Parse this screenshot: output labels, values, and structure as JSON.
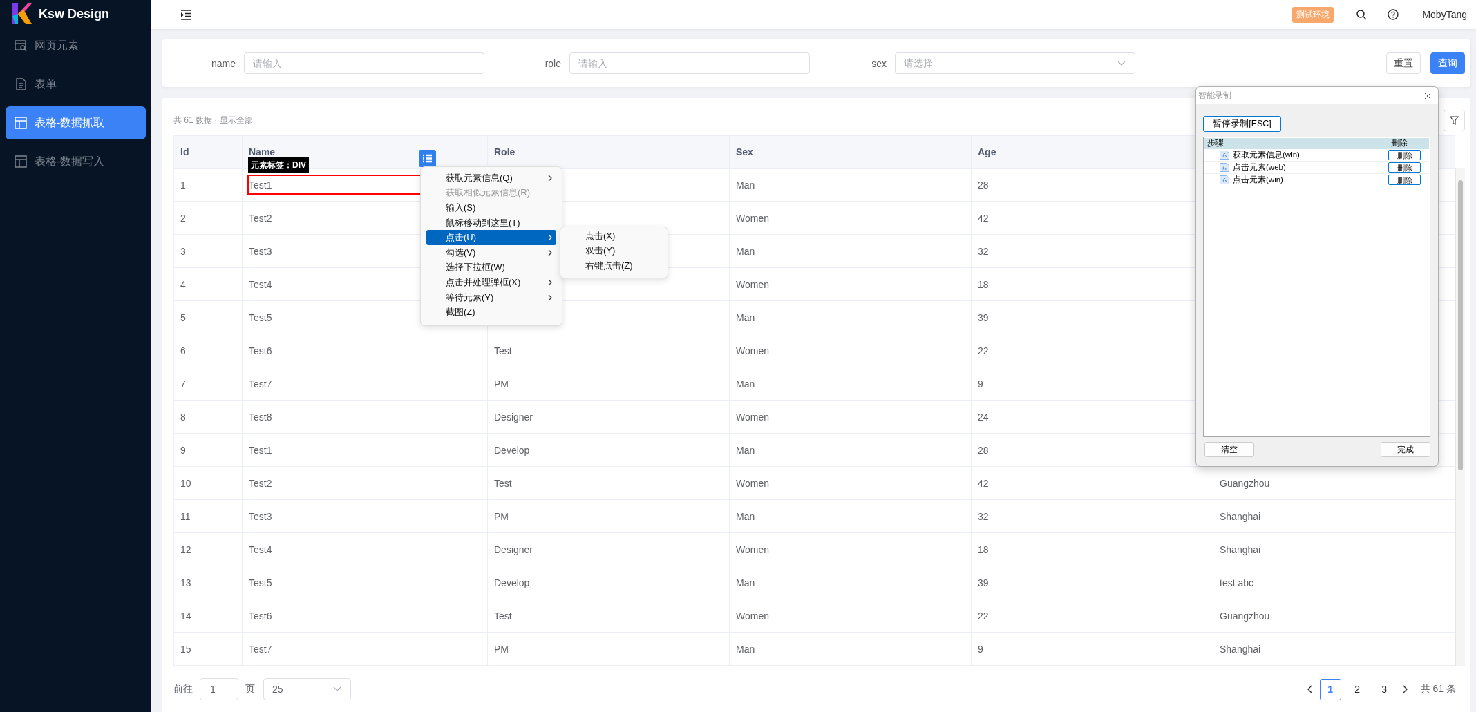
{
  "sidebar": {
    "brand": "Ksw Design",
    "items": [
      {
        "label": "网页元素",
        "selected": false
      },
      {
        "label": "表单",
        "selected": false
      },
      {
        "label": "表格-数据抓取",
        "selected": true
      },
      {
        "label": "表格-数据写入",
        "selected": false
      }
    ]
  },
  "header": {
    "badge": "测试环境",
    "user": "MobyTang"
  },
  "filters": {
    "fields": [
      {
        "label": "name",
        "kind": "input",
        "placeholder": "请输入"
      },
      {
        "label": "role",
        "kind": "input",
        "placeholder": "请输入"
      },
      {
        "label": "sex",
        "kind": "select",
        "placeholder": "请选择"
      }
    ],
    "buttons": [
      {
        "label": "重置",
        "primary": false
      },
      {
        "label": "查询",
        "primary": true
      }
    ]
  },
  "table": {
    "summary": "共 61 数据 · 显示全部",
    "columns": [
      "Id",
      "Name",
      "Role",
      "Sex",
      "Age"
    ],
    "rows": [
      {
        "id": "1",
        "name": "Test1",
        "sex": "Man",
        "age": "28"
      },
      {
        "id": "2",
        "name": "Test2",
        "sex": "Women",
        "age": "42"
      },
      {
        "id": "3",
        "name": "Test3",
        "sex": "Man",
        "age": "32"
      },
      {
        "id": "4",
        "name": "Test4",
        "sex": "Women",
        "age": "18"
      },
      {
        "id": "5",
        "name": "Test5",
        "sex": "Man",
        "age": "39"
      },
      {
        "id": "6",
        "name": "Test6",
        "role": "Test",
        "sex": "Women",
        "age": "22"
      },
      {
        "id": "7",
        "name": "Test7",
        "role": "PM",
        "sex": "Man",
        "age": "9"
      },
      {
        "id": "8",
        "name": "Test8",
        "role": "Designer",
        "sex": "Women",
        "age": "24"
      },
      {
        "id": "9",
        "name": "Test1",
        "role": "Develop",
        "sex": "Man",
        "age": "28"
      },
      {
        "id": "10",
        "name": "Test2",
        "role": "Test",
        "sex": "Women",
        "age": "42",
        "column_6": "Guangzhou"
      },
      {
        "id": "11",
        "name": "Test3",
        "role": "PM",
        "sex": "Man",
        "age": "32",
        "column_6": "Shanghai"
      },
      {
        "id": "12",
        "name": "Test4",
        "role": "Designer",
        "sex": "Women",
        "age": "18",
        "column_6": "Shanghai"
      },
      {
        "id": "13",
        "name": "Test5",
        "role": "Develop",
        "sex": "Man",
        "age": "39",
        "column_6": "test abc"
      },
      {
        "id": "14",
        "name": "Test6",
        "role": "Test",
        "sex": "Women",
        "age": "22",
        "column_6": "Guangzhou"
      },
      {
        "id": "15",
        "name": "Test7",
        "role": "PM",
        "sex": "Man",
        "age": "9",
        "column_6": "Shanghai"
      }
    ]
  },
  "pagination": {
    "goto_label": "前往",
    "page_input": "1",
    "page_suffix": "页",
    "page_size": "25",
    "pages": [
      {
        "label": "1",
        "selected": true
      },
      {
        "label": "2",
        "selected": false
      },
      {
        "label": "3",
        "selected": false
      }
    ],
    "total": "共 61 条"
  },
  "element_tooltip": "元素标签：DIV",
  "context_menu": {
    "items": [
      {
        "label": "获取元素信息(Q)",
        "submenu": true,
        "disabled": false,
        "selected": false
      },
      {
        "label": "获取相似元素信息(R)",
        "submenu": false,
        "disabled": true,
        "selected": false
      },
      {
        "label": "输入(S)",
        "submenu": false,
        "disabled": false,
        "selected": false
      },
      {
        "label": "鼠标移动到这里(T)",
        "submenu": false,
        "disabled": false,
        "selected": false
      },
      {
        "label": "点击(U)",
        "submenu": true,
        "disabled": false,
        "selected": true
      },
      {
        "label": "勾选(V)",
        "submenu": true,
        "disabled": false,
        "selected": false
      },
      {
        "label": "选择下拉框(W)",
        "submenu": false,
        "disabled": false,
        "selected": false
      },
      {
        "label": "点击并处理弹框(X)",
        "submenu": true,
        "disabled": false,
        "selected": false
      },
      {
        "label": "等待元素(Y)",
        "submenu": true,
        "disabled": false,
        "selected": false
      },
      {
        "label": "截图(Z)",
        "submenu": false,
        "disabled": false,
        "selected": false
      }
    ],
    "submenu": [
      "点击(X)",
      "双击(Y)",
      "右键点击(Z)"
    ]
  },
  "record_dialog": {
    "title": "智能录制",
    "pause_button": "暂停录制[ESC]",
    "columns": [
      "步骤",
      "删除"
    ],
    "steps": [
      {
        "label": "获取元素信息(win)",
        "action": "删除"
      },
      {
        "label": "点击元素(web)",
        "action": "删除"
      },
      {
        "label": "点击元素(win)",
        "action": "删除"
      }
    ],
    "buttons": [
      "清空",
      "完成"
    ]
  }
}
